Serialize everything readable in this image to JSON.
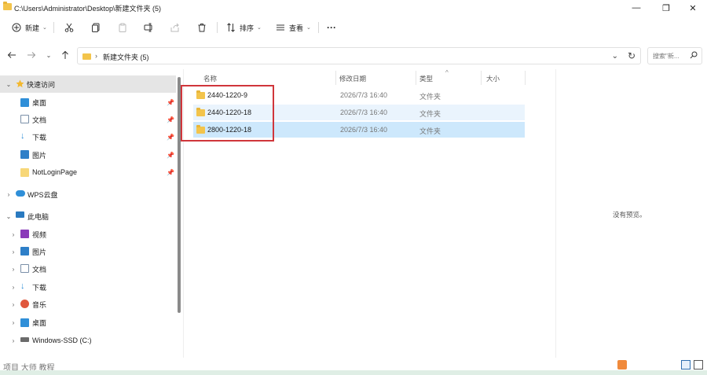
{
  "window": {
    "title": "C:\\Users\\Administrator\\Desktop\\新建文件夹 (5)",
    "minimize_glyph": "—",
    "maximize_glyph": "❐",
    "close_glyph": "✕"
  },
  "toolbar": {
    "new_label": "新建",
    "sort_label": "排序",
    "view_label": "查看",
    "more_glyph": "···"
  },
  "address": {
    "path": "新建文件夹 (5)",
    "separator": "›",
    "search_placeholder": "搜索\"新..."
  },
  "sidebar": {
    "quick_access": "快速访问",
    "quick_items": [
      {
        "label": "桌面",
        "icon": "desktop-icon"
      },
      {
        "label": "文档",
        "icon": "documents-icon"
      },
      {
        "label": "下载",
        "icon": "downloads-icon"
      },
      {
        "label": "图片",
        "icon": "pictures-icon"
      },
      {
        "label": "NotLoginPage",
        "icon": "folder-icon"
      }
    ],
    "wps_cloud": "WPS云盘",
    "this_pc": "此电脑",
    "pc_items": [
      {
        "label": "视频",
        "icon": "videos-icon"
      },
      {
        "label": "图片",
        "icon": "pictures-icon"
      },
      {
        "label": "文档",
        "icon": "documents-icon"
      },
      {
        "label": "下载",
        "icon": "downloads-icon"
      },
      {
        "label": "音乐",
        "icon": "music-icon"
      },
      {
        "label": "桌面",
        "icon": "desktop-icon"
      },
      {
        "label": "Windows-SSD (C:)",
        "icon": "drive-icon"
      }
    ]
  },
  "columns": {
    "name": "名称",
    "date": "修改日期",
    "type": "类型",
    "size": "大小"
  },
  "files": [
    {
      "name": "2440-1220-9",
      "date": "2026/7/3 16:40",
      "type": "文件夹"
    },
    {
      "name": "2440-1220-18",
      "date": "2026/7/3 16:40",
      "type": "文件夹"
    },
    {
      "name": "2800-1220-18",
      "date": "2026/7/3 16:40",
      "type": "文件夹"
    }
  ],
  "preview": {
    "empty_text": "没有预览。"
  },
  "status": {
    "watermark": "项目 大师 教程"
  },
  "colors": {
    "folder": "#f3c44b",
    "selected_row": "#cde8fc",
    "hover_row": "#eaf4fd",
    "highlight_box": "#d0363b"
  }
}
